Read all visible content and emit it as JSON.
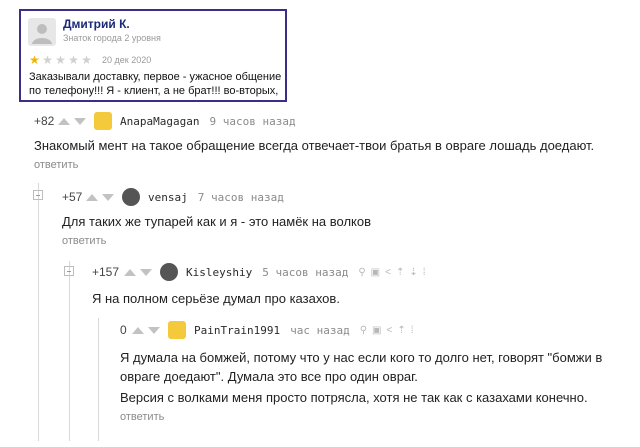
{
  "review": {
    "author": "Дмитрий К.",
    "badge": "Знаток города 2 уровня",
    "rating": 1,
    "max_rating": 5,
    "date": "20 дек 2020",
    "text": "Заказывали доставку, первое - ужасное общение по телефону!!! Я - клиент, а не брат!!! во-вторых,"
  },
  "comments": [
    {
      "score": "+82",
      "user": "AnapaMagagan",
      "time": "9 часов назад",
      "text": "Знакомый мент на такое обращение всегда отвечает-твои братья в овраге лошадь доедают.",
      "reply": "ответить"
    },
    {
      "score": "+57",
      "user": "vensaj",
      "time": "7 часов назад",
      "text": "Для таких же тупарей как и я - это намёк на волков",
      "reply": "ответить"
    },
    {
      "score": "+157",
      "user": "Kisleyshiy",
      "time": "5 часов назад",
      "text": "Я на полном серьёзе думал про казахов.",
      "reply": ""
    },
    {
      "score": "0",
      "user": "PainTrain1991",
      "time": "час назад",
      "text": "Я думала на бомжей, потому что у нас если кого то долго нет, говорят \"бомжи в овраге доедают\". Думала это все про один овраг.",
      "text2": "Версия с волками меня просто потрясла, хотя не так как с казахами конечно.",
      "reply": "ответить"
    }
  ],
  "icons": {
    "tools": [
      "link-icon",
      "save-icon",
      "share-icon",
      "up-icon",
      "down-icon",
      "more-icon"
    ]
  }
}
